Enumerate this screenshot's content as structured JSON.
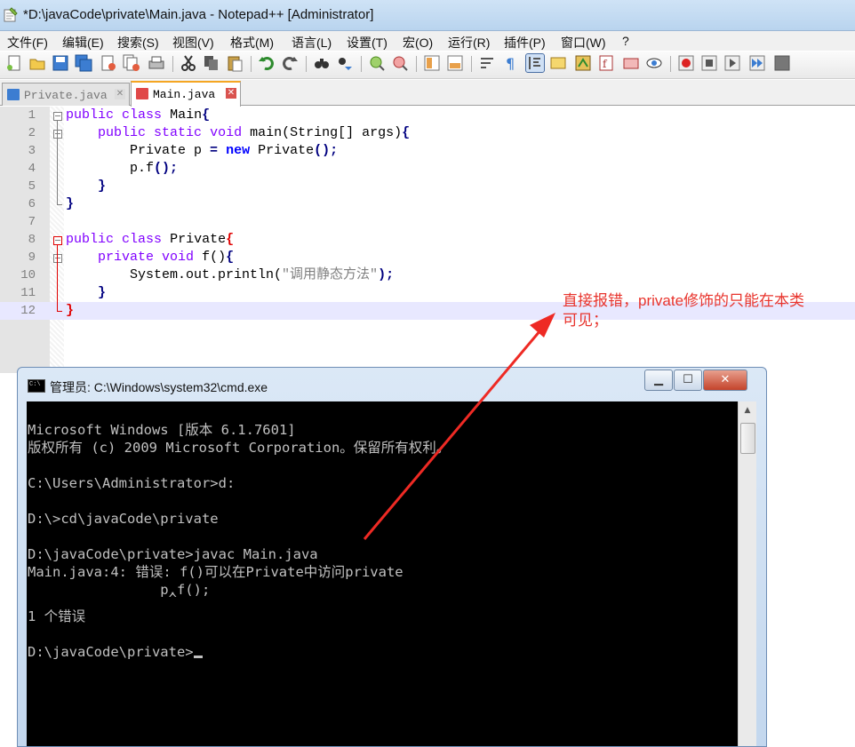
{
  "window": {
    "title": "*D:\\javaCode\\private\\Main.java - Notepad++ [Administrator]"
  },
  "menu": [
    "文件(F)",
    "编辑(E)",
    "搜索(S)",
    "视图(V)",
    "格式(M)",
    "语言(L)",
    "设置(T)",
    "宏(O)",
    "运行(R)",
    "插件(P)",
    "窗口(W)",
    "?"
  ],
  "tabs": [
    {
      "label": "Private.java",
      "active": false
    },
    {
      "label": "Main.java",
      "active": true
    }
  ],
  "line_numbers": [
    "1",
    "2",
    "3",
    "4",
    "5",
    "6",
    "7",
    "8",
    "9",
    "10",
    "11",
    "12"
  ],
  "code": {
    "l1": {
      "kw1": "public",
      "kw2": "class",
      "name": "Main"
    },
    "l2": {
      "kw1": "public",
      "kw2": "static",
      "kw3": "void",
      "rest": "main(String[] args)"
    },
    "l3": {
      "t1": "Private p",
      "op": "=",
      "kw": "new",
      "t2": "Private",
      "tail": "();"
    },
    "l4": {
      "t": "p.f",
      "tail": "();"
    },
    "l8": {
      "kw1": "public",
      "kw2": "class",
      "name": "Private"
    },
    "l9": {
      "kw1": "private",
      "kw2": "void",
      "rest": "f()"
    },
    "l10": {
      "t1": "System.out.println(",
      "str": "\"调用静态方法\"",
      "tail": ");"
    }
  },
  "annotation": {
    "line1": "直接报错，private修饰的只能在本类",
    "line2": "可见；"
  },
  "cmd": {
    "title": "管理员: C:\\Windows\\system32\\cmd.exe",
    "icon_text": "C:\\",
    "buttons": {
      "minimize": "▁",
      "maximize": "☐",
      "close": "✕"
    },
    "lines": [
      "Microsoft Windows [版本 6.1.7601]",
      "版权所有 (c) 2009 Microsoft Corporation。保留所有权利。",
      "",
      "C:\\Users\\Administrator>d:",
      "",
      "D:\\>cd\\javaCode\\private",
      "",
      "D:\\javaCode\\private>javac Main.java",
      "Main.java:4: 错误: f()可以在Private中访问private",
      "                p.f();",
      "                 ^",
      "1 个错误",
      "",
      "D:\\javaCode\\private>"
    ]
  },
  "colors": {
    "keyword": "#8000ff",
    "keyword_bold": "#0000ff",
    "annotation": "#e8342d",
    "current_line": "#e8e8ff"
  }
}
